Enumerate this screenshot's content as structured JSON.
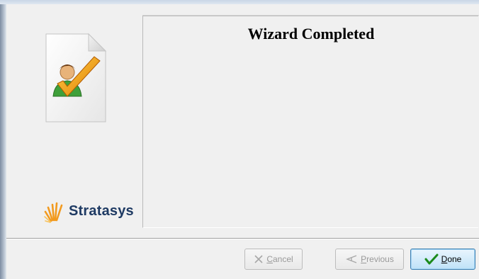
{
  "wizard": {
    "title": "Wizard Completed",
    "brand": "Stratasys"
  },
  "buttons": {
    "cancel": {
      "accel": "C",
      "rest": "ancel",
      "enabled": false
    },
    "previous": {
      "accel": "P",
      "rest": "revious",
      "enabled": false
    },
    "done": {
      "accel": "D",
      "rest": "one",
      "enabled": true
    }
  },
  "icons": {
    "document": "document-user-check-icon",
    "logo": "stratasys-logo-icon",
    "cancel": "x-icon",
    "previous": "back-arrow-icon",
    "done": "checkmark-icon"
  },
  "colors": {
    "brand_text": "#1e3a63",
    "brand_accent": "#f29a1f",
    "done_border": "#3c7fb1",
    "check_green": "#1b8a1b"
  }
}
